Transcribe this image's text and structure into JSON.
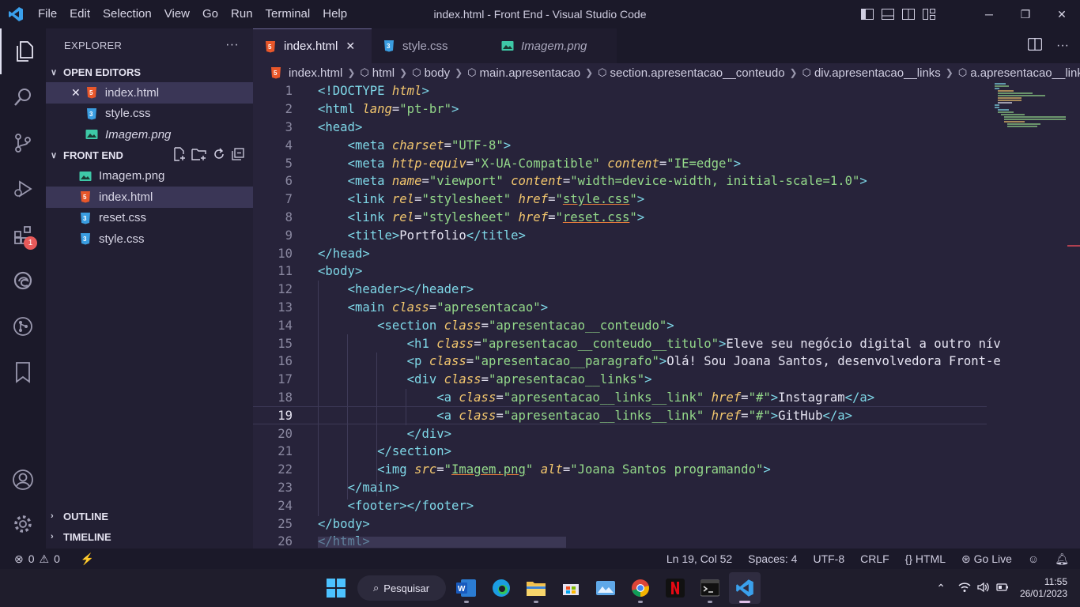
{
  "window": {
    "title": "index.html - Front End - Visual Studio Code",
    "menu": [
      "File",
      "Edit",
      "Selection",
      "View",
      "Go",
      "Run",
      "Terminal",
      "Help"
    ]
  },
  "activity_bar": {
    "extensions_badge": "1"
  },
  "explorer": {
    "header": "EXPLORER",
    "more": "···",
    "open_editors": {
      "label": "OPEN EDITORS",
      "items": [
        {
          "name": "index.html",
          "type": "html",
          "close": "✕"
        },
        {
          "name": "style.css",
          "type": "css"
        },
        {
          "name": "Imagem.png",
          "type": "img"
        }
      ]
    },
    "folder": {
      "label": "FRONT END",
      "items": [
        {
          "name": "Imagem.png",
          "type": "img"
        },
        {
          "name": "index.html",
          "type": "html"
        },
        {
          "name": "reset.css",
          "type": "css"
        },
        {
          "name": "style.css",
          "type": "css"
        }
      ]
    },
    "outline_label": "OUTLINE",
    "timeline_label": "TIMELINE"
  },
  "tabs": [
    {
      "label": "index.html",
      "type": "html",
      "close": "✕"
    },
    {
      "label": "style.css",
      "type": "css"
    },
    {
      "label": "Imagem.png",
      "type": "img"
    }
  ],
  "breadcrumb": [
    "index.html",
    "html",
    "body",
    "main.apresentacao",
    "section.apresentacao__conteudo",
    "div.apresentacao__links",
    "a.apresentacao__links__link"
  ],
  "code_lines": [
    "<!DOCTYPE html>",
    "<html lang=\"pt-br\">",
    "<head>",
    "    <meta charset=\"UTF-8\">",
    "    <meta http-equiv=\"X-UA-Compatible\" content=\"IE=edge\">",
    "    <meta name=\"viewport\" content=\"width=device-width, initial-scale=1.0\">",
    "    <link rel=\"stylesheet\" href=\"style.css\">",
    "    <link rel=\"stylesheet\" href=\"reset.css\">",
    "    <title>Portfolio</title>",
    "</head>",
    "<body>",
    "    <header></header>",
    "    <main class=\"apresentacao\">",
    "        <section class=\"apresentacao__conteudo\">",
    "            <h1 class=\"apresentacao__conteudo__titulo\">Eleve seu negócio digital a outro nív",
    "            <p class=\"apresentacao__paragrafo\">Olá! Sou Joana Santos, desenvolvedora Front-e",
    "            <div class=\"apresentacao__links\">",
    "                <a class=\"apresentacao__links__link\" href=\"#\">Instagram</a>",
    "                <a class=\"apresentacao__links__link\" href=\"#\">GitHub</a>",
    "            </div>",
    "        </section>",
    "        <img src=\"Imagem.png\" alt=\"Joana Santos programando\">",
    "    </main>",
    "    <footer></footer>",
    "</body>",
    "</html>"
  ],
  "current_line": 19,
  "status": {
    "errors": "0",
    "warnings": "0",
    "position": "Ln 19, Col 52",
    "spaces": "Spaces: 4",
    "encoding": "UTF-8",
    "eol": "CRLF",
    "language": "HTML",
    "golive": "Go Live"
  },
  "taskbar": {
    "search_label": "Pesquisar",
    "time": "11:55",
    "date": "26/01/2023"
  },
  "colors": {
    "tag": "#7fd8e8",
    "attribute": "#f3c76e",
    "string": "#94d98a",
    "background": "#27233a"
  }
}
